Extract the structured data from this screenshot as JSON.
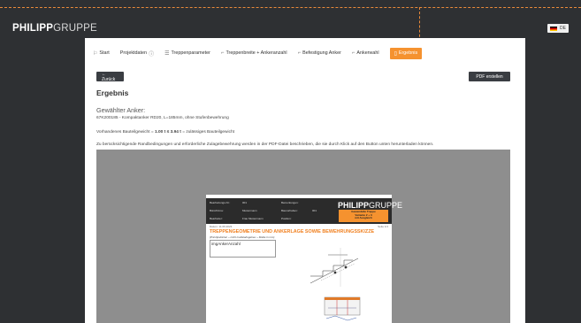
{
  "brand": {
    "bold": "PHILIPP",
    "light": "GRUPPE"
  },
  "language": {
    "code": "DE"
  },
  "nav": [
    {
      "label": "Start",
      "icon": "flag-icon"
    },
    {
      "label": "Projektdaten",
      "icon": "info-icon"
    },
    {
      "label": "Treppenparameter",
      "icon": "list-icon"
    },
    {
      "label": "Treppenbreite + Ankeranzahl",
      "icon": "stairs-icon"
    },
    {
      "label": "Befestigung Anker",
      "icon": "stairs-icon"
    },
    {
      "label": "Ankerwahl",
      "icon": "stairs-icon"
    },
    {
      "label": "Ergebnis",
      "icon": "document-icon",
      "active": true
    }
  ],
  "actions": {
    "back": "← Zurück",
    "pdf": "PDF erstellen"
  },
  "result": {
    "title": "Ergebnis",
    "anchor_heading": "Gewählter Anker:",
    "anchor_text": "67K200185 - Kompaktanker RD20, L=185mm, ohne Stufenbewehrung",
    "weight_prefix": "Vorhandenes Bauteilgewicht = ",
    "weight_value": "1.00 t ≤ 3.94 t",
    "weight_suffix": " = zulässiges Bauteilgewicht",
    "note": "Zu berücksichtigende Randbedingungen und erforderliche Zulagebewehrung werden in der PDF-Datei beschrieben, die sie durch Klick auf den Button unten herunterladen können."
  },
  "pdf_preview": {
    "rows": [
      [
        "Bearbeitungs-Nr.:",
        "001",
        "Bemerkungen:",
        ""
      ],
      [
        "Büro/Firma:",
        "Mustermann",
        "Bauvorhaben:",
        "001"
      ],
      [
        "Bearbeiter:",
        "Frau Mustermann",
        "Position:",
        ""
      ]
    ],
    "badge": [
      "Gewendelte Treppe",
      "Variante 2 + 3",
      "mit Ausgleich"
    ],
    "date": "Datum: 11.06.2023",
    "page": "Seite 1/1",
    "title": "TREPPENGEOMETRIE UND ANKERLAGE SOWIE BEWEHRUNGSSKIZZE",
    "subtitle": "(Prinzipskizzen – nicht maßstabsgetreu – Maße in mm)",
    "box_text": "imgAnkerAnzahl"
  },
  "colors": {
    "accent": "#f5922f",
    "dark": "#3a3d42",
    "bg": "#2e3033"
  }
}
